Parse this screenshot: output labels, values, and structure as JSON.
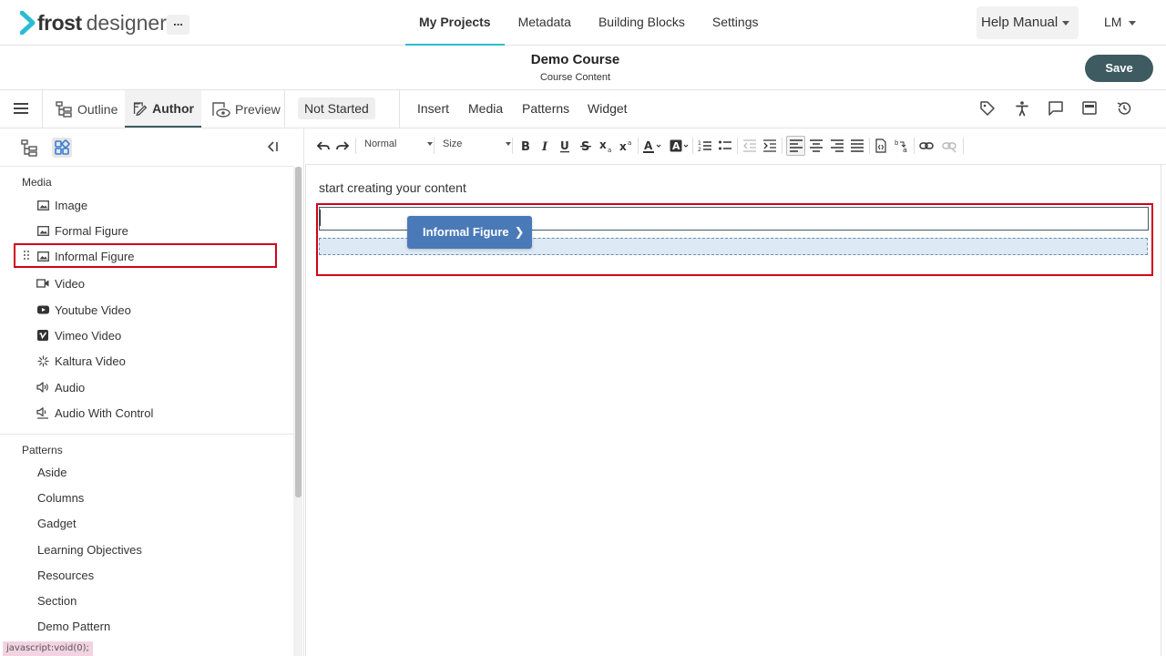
{
  "brand": {
    "name_bold": "frost",
    "name_light": "designer",
    "accent": "#2bbcd2"
  },
  "nav": {
    "more_label": "...",
    "tabs": [
      "My Projects",
      "Metadata",
      "Building Blocks",
      "Settings"
    ],
    "help_label": "Help Manual",
    "user_label": "LM"
  },
  "course": {
    "title": "Demo Course",
    "subtitle": "Course Content",
    "save_label": "Save"
  },
  "modes": {
    "outline": "Outline",
    "author": "Author",
    "preview": "Preview",
    "status": "Not Started"
  },
  "menu": [
    "Insert",
    "Media",
    "Patterns",
    "Widget"
  ],
  "right_icons": [
    "tag-icon",
    "accessibility-icon",
    "comment-icon",
    "window-icon",
    "history-icon"
  ],
  "toolbar": {
    "format": "Normal",
    "size": "Size"
  },
  "sidebar": {
    "media_heading": "Media",
    "media_items": [
      {
        "label": "Image",
        "icon": "image-icon"
      },
      {
        "label": "Formal Figure",
        "icon": "image-icon"
      },
      {
        "label": "Informal Figure",
        "icon": "image-icon"
      },
      {
        "label": "Video",
        "icon": "video-icon"
      },
      {
        "label": "Youtube Video",
        "icon": "youtube-icon"
      },
      {
        "label": "Vimeo Video",
        "icon": "vimeo-icon"
      },
      {
        "label": "Kaltura Video",
        "icon": "kaltura-icon"
      },
      {
        "label": "Audio",
        "icon": "audio-icon"
      },
      {
        "label": "Audio With Control",
        "icon": "audio-control-icon"
      }
    ],
    "patterns_heading": "Patterns",
    "pattern_items": [
      "Aside",
      "Columns",
      "Gadget",
      "Learning Objectives",
      "Resources",
      "Section",
      "Demo Pattern"
    ]
  },
  "editor": {
    "placeholder": "start creating your content",
    "drag_chip": "Informal Figure"
  },
  "statusbar": "javascript:void(0);",
  "colors": {
    "highlight": "#d0021b",
    "save_bg": "#3d5b61",
    "chip_bg": "#4a79b8"
  }
}
